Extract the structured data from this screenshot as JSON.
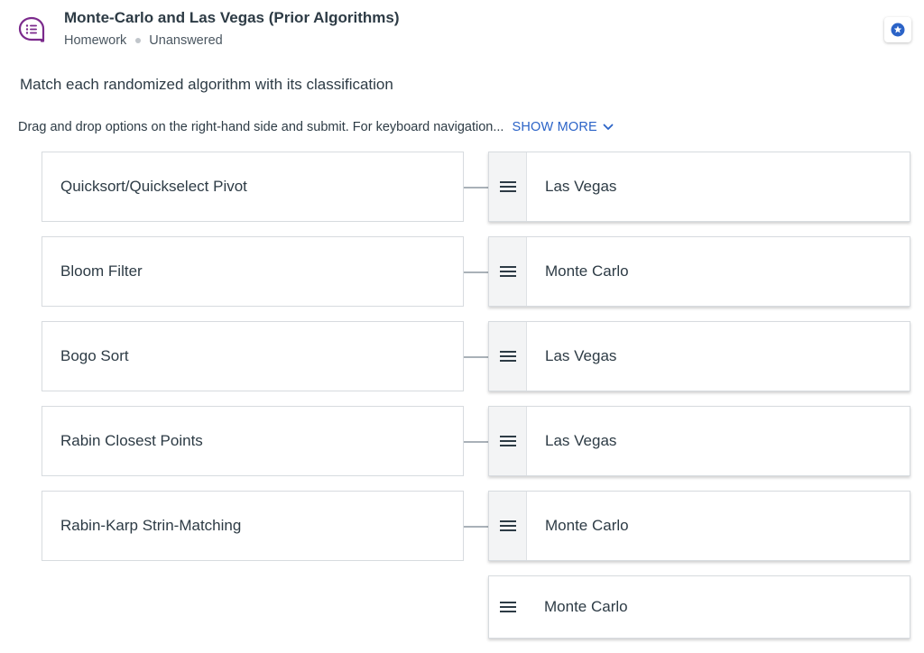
{
  "question": {
    "title": "Monte-Carlo and Las Vegas (Prior Algorithms)",
    "category": "Homework",
    "status": "Unanswered",
    "icon": "discussion-list-icon",
    "accent_color": "#7b2a8c"
  },
  "prompt": "Match each randomized algorithm with its classification",
  "instructions": "Drag and drop options on the right-hand side and submit. For keyboard navigation...",
  "show_more_label": "SHOW MORE",
  "link_color": "#2b63c7",
  "pairs": [
    {
      "prompt": "Quicksort/Quickselect Pivot",
      "answer": "Las Vegas"
    },
    {
      "prompt": "Bloom Filter",
      "answer": "Monte Carlo"
    },
    {
      "prompt": "Bogo Sort",
      "answer": "Las Vegas"
    },
    {
      "prompt": "Rabin Closest Points",
      "answer": "Las Vegas"
    },
    {
      "prompt": "Rabin-Karp Strin-Matching",
      "answer": "Monte Carlo"
    }
  ],
  "extra_option": {
    "answer": "Monte Carlo"
  }
}
